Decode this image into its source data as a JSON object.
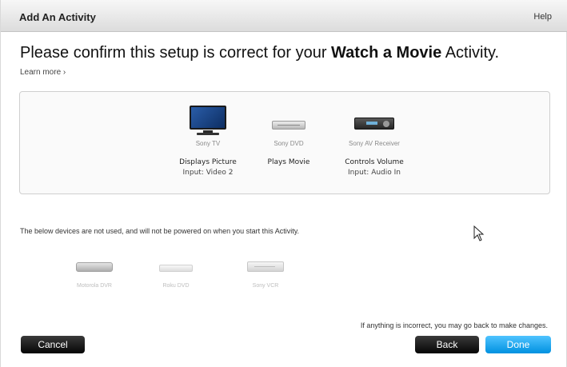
{
  "titlebar": {
    "title": "Add An Activity",
    "help": "Help"
  },
  "headline": {
    "prefix": "Please confirm this setup is correct for your ",
    "activity": "Watch a Movie",
    "suffix": " Activity."
  },
  "learn_more": "Learn more ›",
  "devices": [
    {
      "name": "Sony TV",
      "role": "Displays Picture",
      "input": "Input: Video 2",
      "icon": "tv-icon"
    },
    {
      "name": "Sony DVD",
      "role": "Plays Movie",
      "input": "",
      "icon": "dvd-player-icon"
    },
    {
      "name": "Sony AV Receiver",
      "role": "Controls Volume",
      "input": "Input: Audio In",
      "icon": "av-receiver-icon"
    }
  ],
  "unused_note": "The below devices are not used, and will not be powered on when you start this Activity.",
  "unused_devices": [
    {
      "name": "Motorola DVR",
      "icon": "dvr-icon"
    },
    {
      "name": "Roku DVD",
      "icon": "dvd-player-icon"
    },
    {
      "name": "Sony VCR",
      "icon": "vcr-icon"
    }
  ],
  "footnote": "If anything is incorrect, you may go back to make changes.",
  "buttons": {
    "cancel": "Cancel",
    "back": "Back",
    "done": "Done"
  },
  "colors": {
    "done_button": "#1aa8f0",
    "dark_button": "#1a1a1a"
  }
}
